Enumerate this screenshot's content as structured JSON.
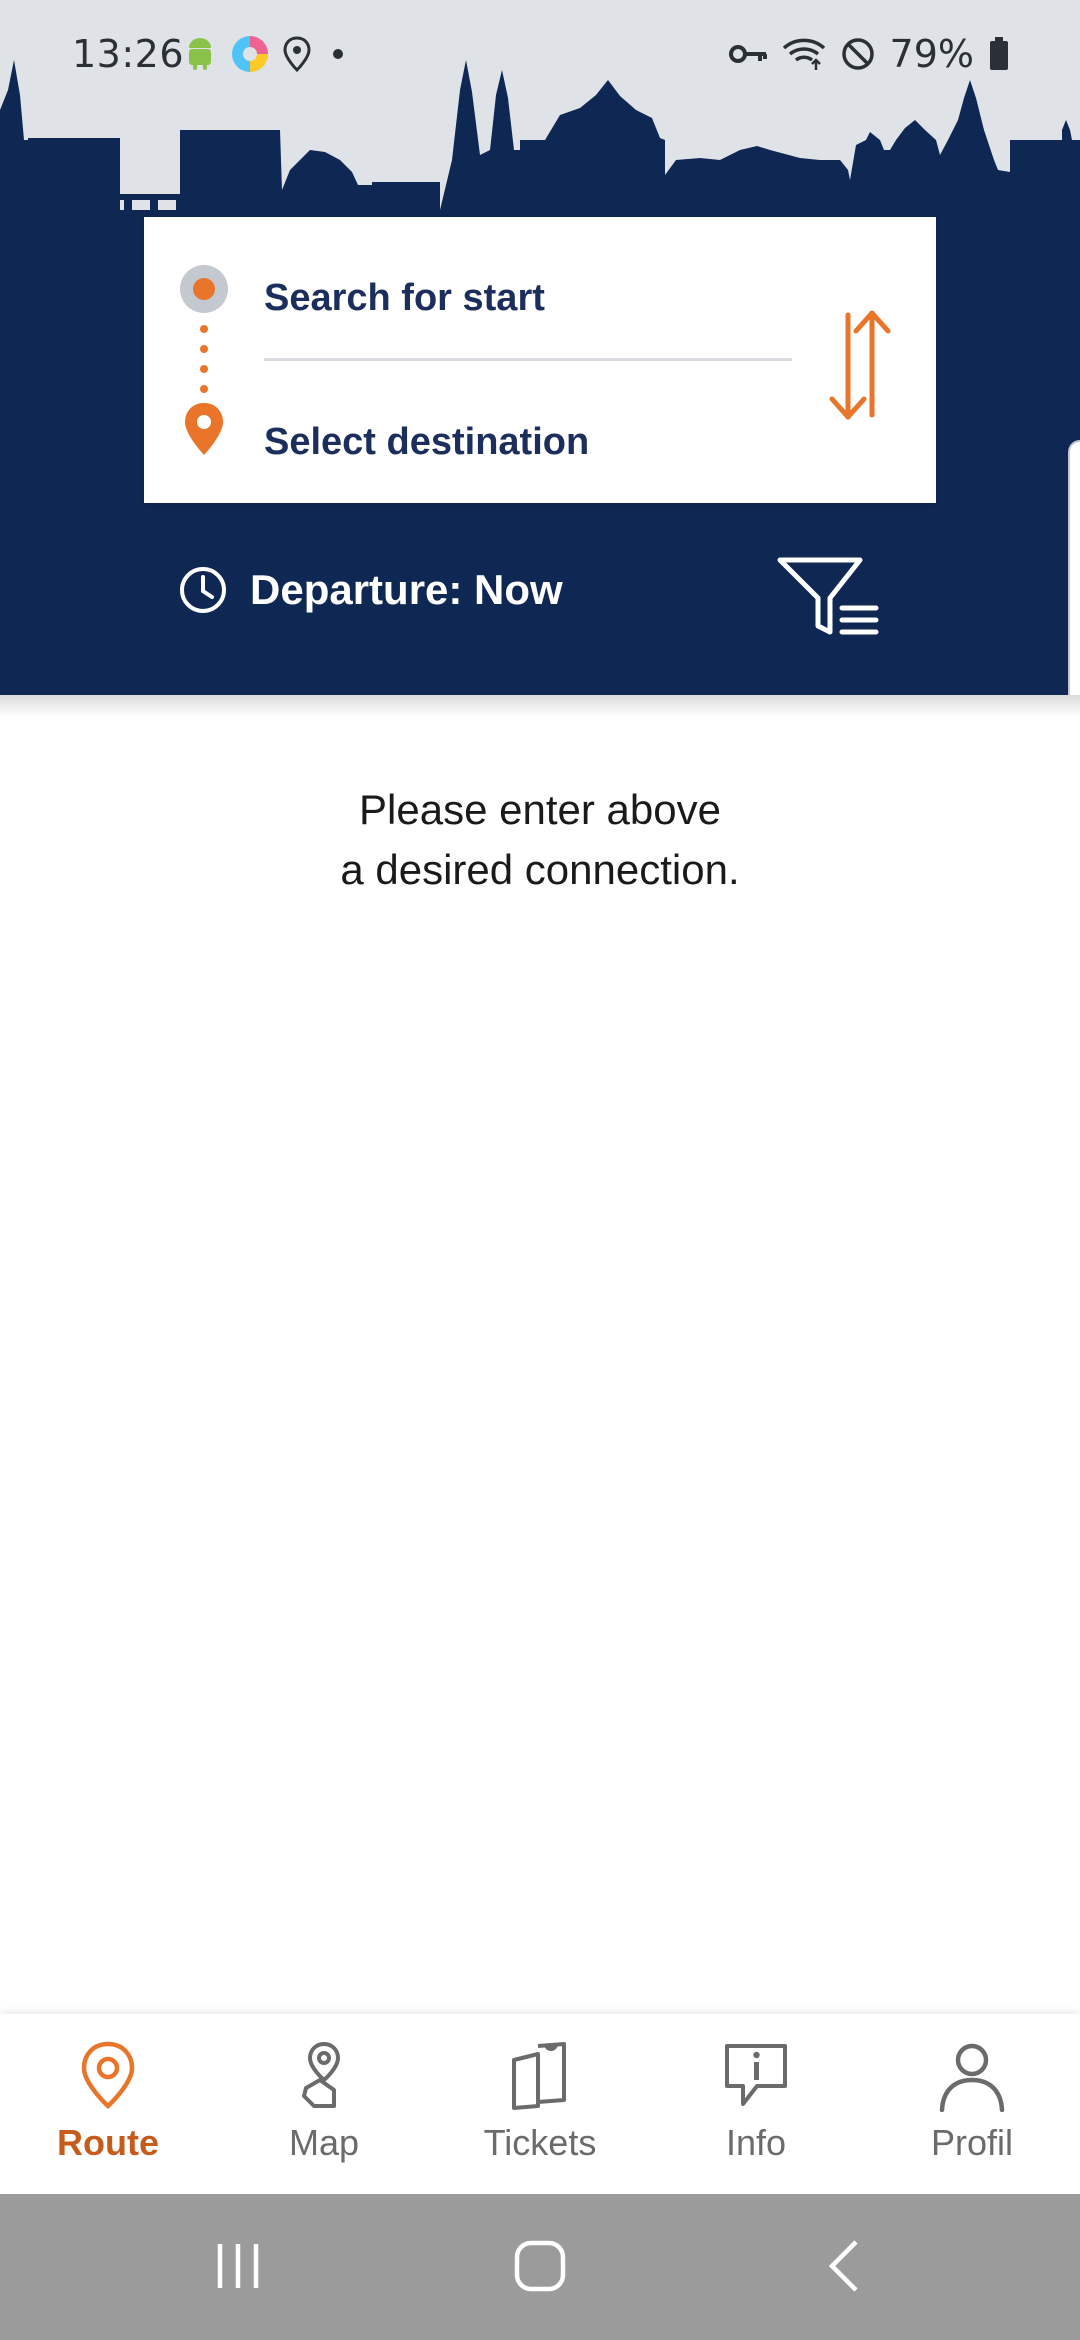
{
  "status_bar": {
    "time": "13:26",
    "battery": "79%",
    "icons": [
      "android-icon",
      "photos-icon",
      "location-icon",
      "dot-icon",
      "vpn-key-icon",
      "wifi-icon",
      "do-not-disturb-icon",
      "battery-icon"
    ]
  },
  "search": {
    "start_placeholder": "Search for start",
    "destination_placeholder": "Select destination"
  },
  "departure": {
    "label": "Departure: Now"
  },
  "message": {
    "line1": "Please enter above",
    "line2": "a desired connection."
  },
  "bottom_nav": {
    "items": [
      {
        "label": "Route",
        "icon": "route-pin-icon",
        "active": true
      },
      {
        "label": "Map",
        "icon": "map-pin-hand-icon",
        "active": false
      },
      {
        "label": "Tickets",
        "icon": "tickets-icon",
        "active": false
      },
      {
        "label": "Info",
        "icon": "info-bubble-icon",
        "active": false
      },
      {
        "label": "Profil",
        "icon": "profile-icon",
        "active": false
      }
    ]
  },
  "colors": {
    "navy": "#0f2753",
    "accent_orange": "#e8752a",
    "active_nav": "#c55c1c",
    "sky": "#dfe3e8"
  }
}
